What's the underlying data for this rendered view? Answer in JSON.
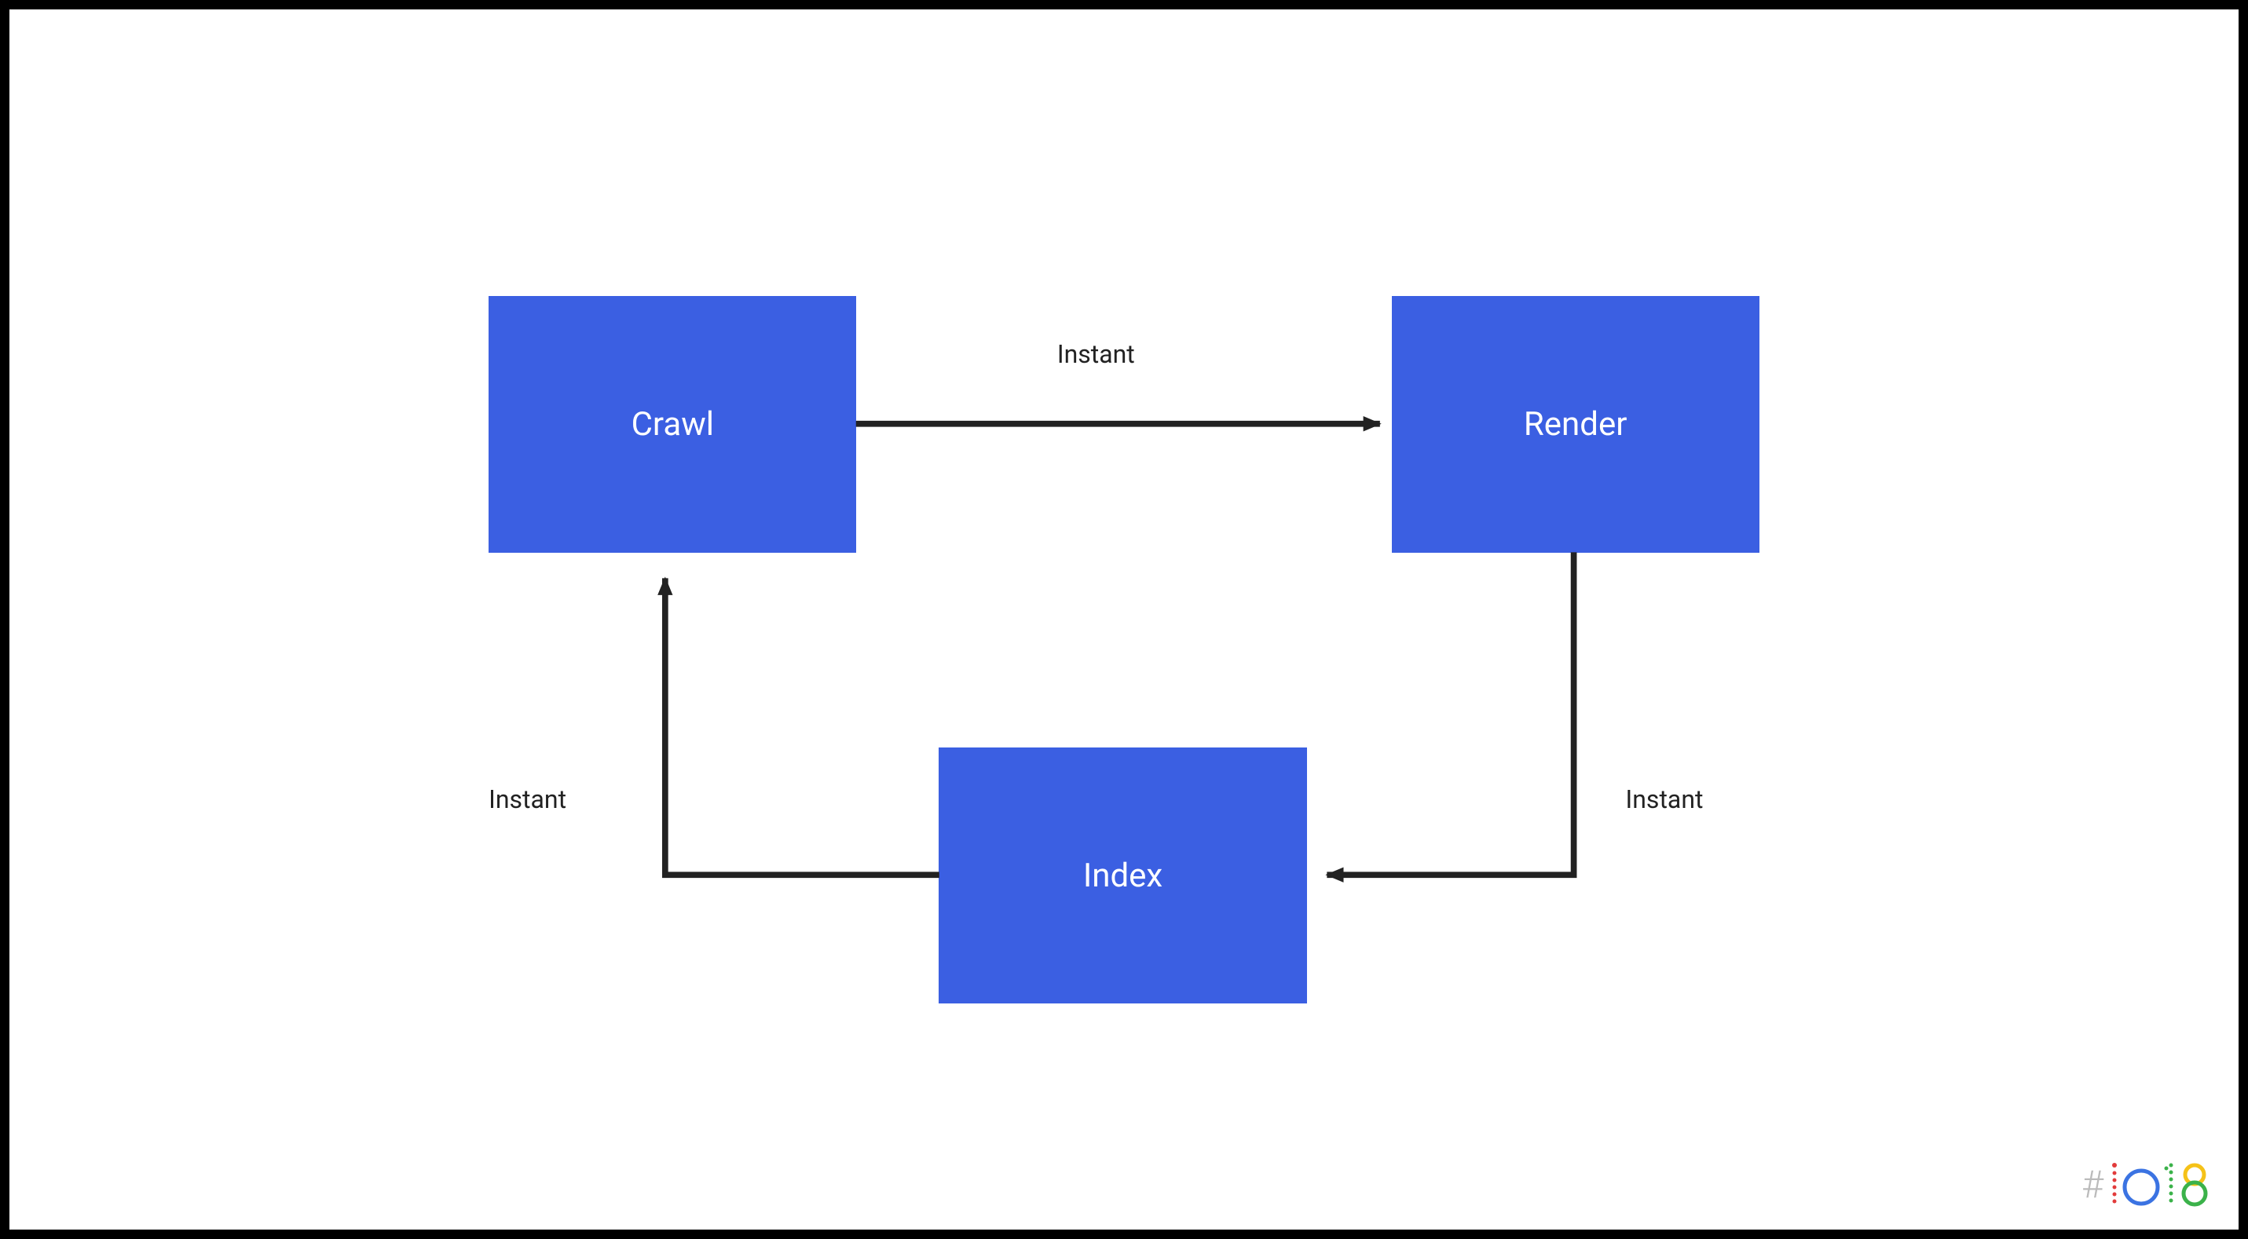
{
  "diagram": {
    "boxes": {
      "crawl": "Crawl",
      "render": "Render",
      "index": "Index"
    },
    "labels": {
      "crawl_to_render": "Instant",
      "render_to_index": "Instant",
      "index_to_crawl": "Instant"
    }
  },
  "logo": {
    "hashtag": "#",
    "text": "io18"
  },
  "colors": {
    "box_bg": "#3b5fe2",
    "box_text": "#ffffff",
    "arrow": "#222222",
    "label_text": "#222222",
    "logo_i_dots": "#e23b3b",
    "logo_o": "#3b73e2",
    "logo_1_dots": "#3bb24a",
    "logo_8_top": "#f5c218",
    "logo_8_bottom": "#3bb24a"
  }
}
